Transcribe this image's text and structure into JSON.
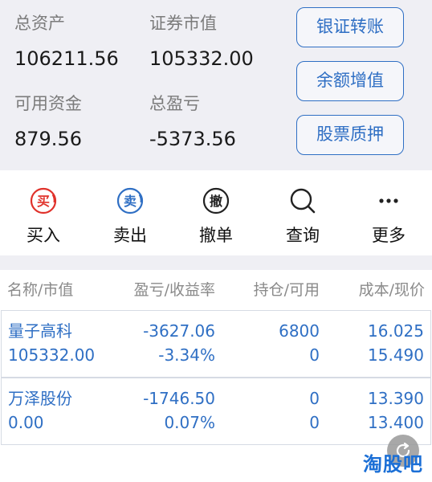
{
  "summary": {
    "total_assets_label": "总资产",
    "total_assets_value": "106211.56",
    "market_value_label": "证券市值",
    "market_value_value": "105332.00",
    "available_funds_label": "可用资金",
    "available_funds_value": "879.56",
    "total_pl_label": "总盈亏",
    "total_pl_value": "-5373.56"
  },
  "actions": {
    "bank_transfer": "银证转账",
    "balance_growth": "余额增值",
    "stock_pledge": "股票质押"
  },
  "menu": {
    "buy": {
      "label": "买入",
      "icon": "buy-icon",
      "glyph": "买"
    },
    "sell": {
      "label": "卖出",
      "icon": "sell-icon",
      "glyph": "卖"
    },
    "cancel": {
      "label": "撤单",
      "icon": "cancel-order-icon",
      "glyph": "撤"
    },
    "query": {
      "label": "查询",
      "icon": "search-icon"
    },
    "more": {
      "label": "更多",
      "icon": "more-icon"
    }
  },
  "table": {
    "headers": [
      "名称/市值",
      "盈亏/收益率",
      "持仓/可用",
      "成本/现价"
    ],
    "rows": [
      {
        "name": "量子高科",
        "market_value": "105332.00",
        "pl": "-3627.06",
        "return_rate": "-3.34%",
        "position": "6800",
        "available": "0",
        "cost": "16.025",
        "price": "15.490"
      },
      {
        "name": "万泽股份",
        "market_value": "0.00",
        "pl": "-1746.50",
        "return_rate": "0.07%",
        "position": "0",
        "available": "0",
        "cost": "13.390",
        "price": "13.400"
      }
    ]
  },
  "watermark": "淘股吧",
  "colors": {
    "accent": "#2f6fc4",
    "buy_red": "#e0322b",
    "sell_blue": "#2f6fc4",
    "panel_bg": "#efeff4"
  }
}
